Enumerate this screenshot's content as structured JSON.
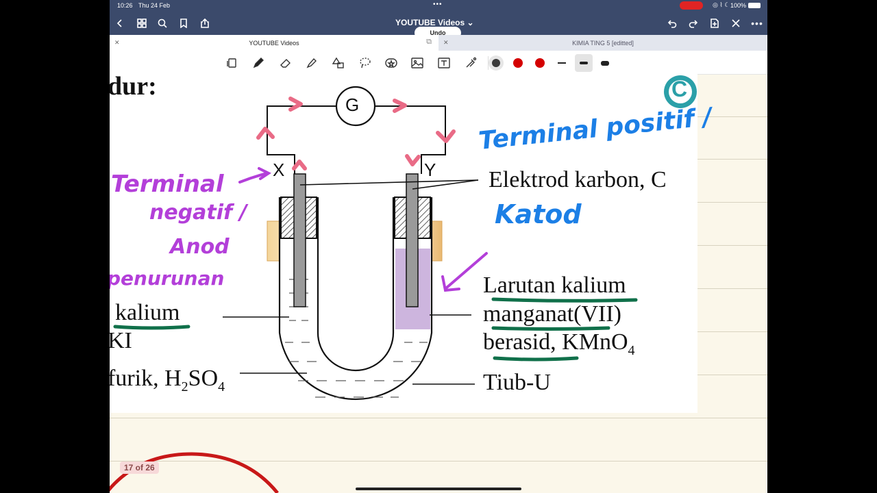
{
  "status_bar": {
    "time": "10:26",
    "date": "Thu 24 Feb",
    "battery": "100%"
  },
  "nav": {
    "doc_title": "YOUTUBE Videos",
    "undo_label": "Undo"
  },
  "tabs": [
    {
      "label": "YOUTUBE Videos",
      "active": true
    },
    {
      "label": "KIMIA TING 5 [editted]",
      "active": false
    }
  ],
  "toolbar": {
    "tools": [
      "page-view-icon",
      "pen-icon",
      "eraser-icon",
      "highlighter-icon",
      "shapes-icon",
      "lasso-icon",
      "sticker-icon",
      "image-icon",
      "text-icon",
      "laser-pointer-icon"
    ],
    "pen_colors": [
      "#333333",
      "#d40000",
      "#d40000"
    ],
    "widths": [
      "thin",
      "medium",
      "thick"
    ]
  },
  "page": {
    "heading_fragment": "dur:",
    "galvanometer": "G",
    "electrode_x": "X",
    "electrode_y": "Y",
    "label_electrode": "Elektrod karbon, C",
    "label_left1": "kalium",
    "label_left2": "KI",
    "label_left3_a": "furik, H",
    "label_left3_sub": "2",
    "label_left3_b": "SO",
    "label_left3_sub2": "4",
    "label_right1": "Larutan kalium",
    "label_right2": "manganat(VII)",
    "label_right3": "berasid, KMnO",
    "label_right3_sub": "4",
    "label_tube": "Tiub-U",
    "corner_logo": "C"
  },
  "annotations": {
    "pink_left": [
      "Terminal",
      "negatif /",
      "Anod",
      "penurunan"
    ],
    "blue_right": [
      "Terminal positif /",
      "Katod"
    ],
    "annotation_colors": {
      "pink": "#e96b86",
      "purple": "#b33fd9",
      "blue": "#1c7fe6",
      "green": "#10704a",
      "red": "#c81818"
    }
  },
  "page_indicator": "17 of 26"
}
